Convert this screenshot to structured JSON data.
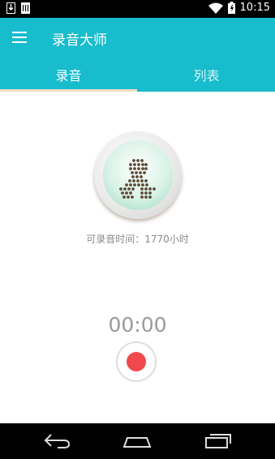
{
  "status_bar": {
    "time": "10:15",
    "icons": [
      "download-icon",
      "storage-icon",
      "wifi-icon",
      "battery-icon"
    ]
  },
  "app_bar": {
    "title": "录音大师",
    "menu_icon": "menu-icon"
  },
  "tabs": [
    {
      "label": "录音",
      "selected": true
    },
    {
      "label": "列表",
      "selected": false
    }
  ],
  "main": {
    "logo_icon": "microphone-dots-logo",
    "available_time": "可录音时间：1770小时",
    "timer": "00:00",
    "record_button_icon": "record-icon"
  },
  "nav_bar": {
    "icons": [
      "back-icon",
      "home-icon",
      "recent-apps-icon"
    ]
  },
  "colors": {
    "accent": "#17bccd",
    "tab_indicator": "#f6ddc7",
    "record": "#f0494d"
  }
}
